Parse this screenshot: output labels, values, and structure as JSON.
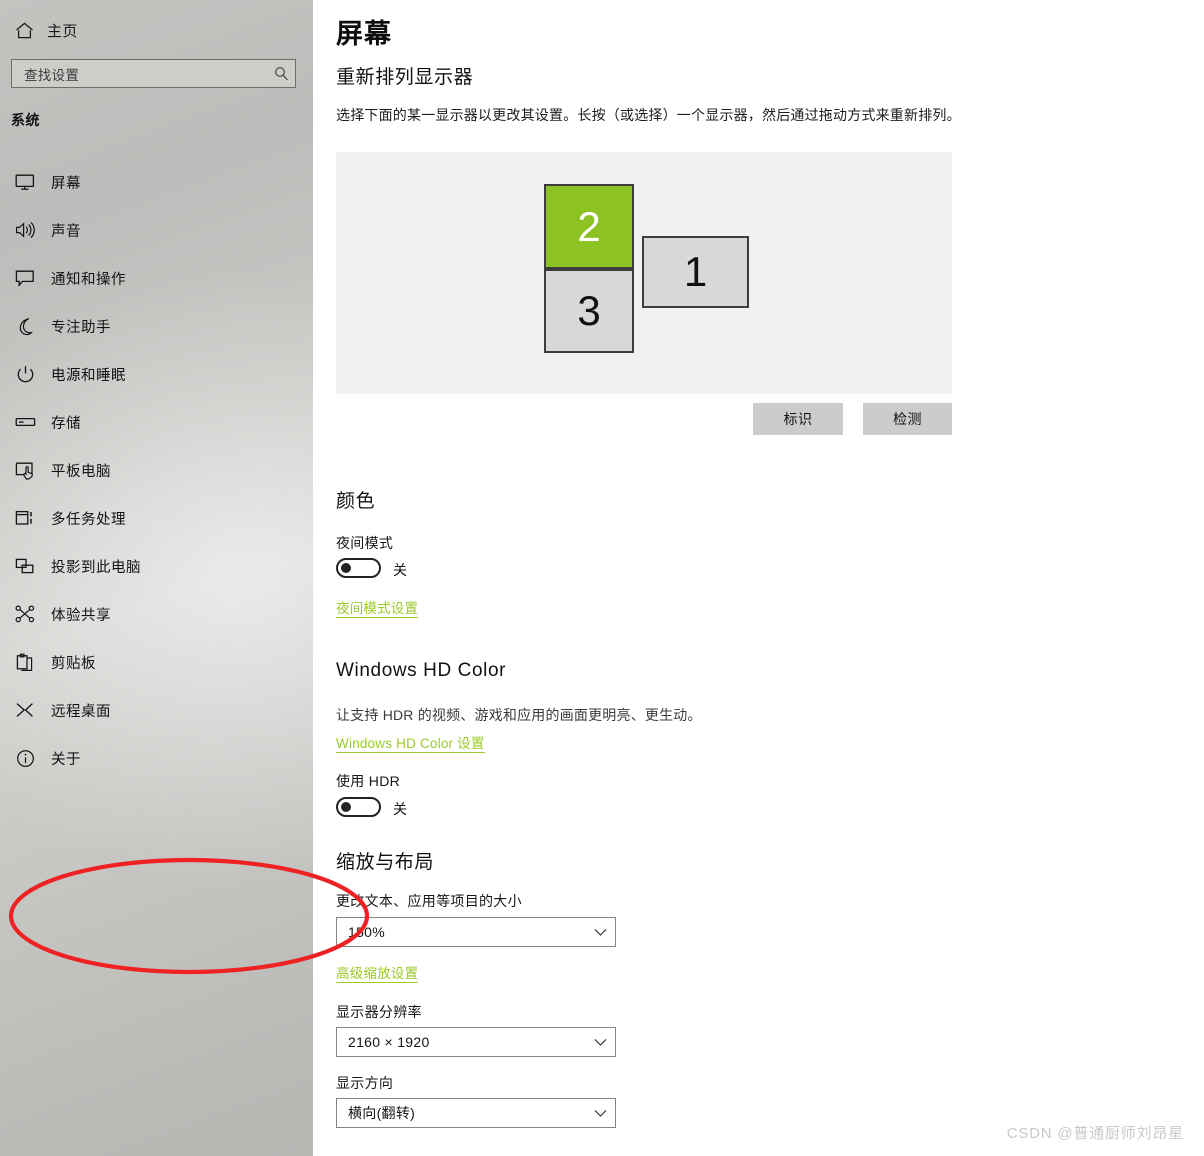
{
  "sidebar": {
    "home": {
      "label": "主页",
      "icon": "home-icon"
    },
    "search": {
      "value": "查找设置",
      "placeholder": "查找设置",
      "icon": "search-icon"
    },
    "heading": "系统",
    "items": [
      {
        "label": "屏幕",
        "icon": "monitor-icon",
        "selected": true
      },
      {
        "label": "声音",
        "icon": "speaker-icon",
        "selected": false
      },
      {
        "label": "通知和操作",
        "icon": "notification-icon",
        "selected": false
      },
      {
        "label": "专注助手",
        "icon": "moon-icon",
        "selected": false
      },
      {
        "label": "电源和睡眠",
        "icon": "power-icon",
        "selected": false
      },
      {
        "label": "存储",
        "icon": "storage-icon",
        "selected": false
      },
      {
        "label": "平板电脑",
        "icon": "tablet-icon",
        "selected": false
      },
      {
        "label": "多任务处理",
        "icon": "multitask-icon",
        "selected": false
      },
      {
        "label": "投影到此电脑",
        "icon": "projection-icon",
        "selected": false
      },
      {
        "label": "体验共享",
        "icon": "share-icon",
        "selected": false
      },
      {
        "label": "剪贴板",
        "icon": "clipboard-icon",
        "selected": false
      },
      {
        "label": "远程桌面",
        "icon": "remote-desktop-icon",
        "selected": false
      },
      {
        "label": "关于",
        "icon": "info-icon",
        "selected": false
      }
    ]
  },
  "main": {
    "page_title": "屏幕",
    "rearrange": {
      "heading": "重新排列显示器",
      "description": "选择下面的某一显示器以更改其设置。长按（或选择）一个显示器，然后通过拖动方式来重新排列。",
      "monitors": [
        {
          "number": "2",
          "selected": true,
          "color": "#8cc323"
        },
        {
          "number": "3",
          "selected": false,
          "color": "#d8d8d8"
        },
        {
          "number": "1",
          "selected": false,
          "color": "#d8d8d8"
        }
      ],
      "identify_button": "标识",
      "detect_button": "检测"
    },
    "color_section": {
      "heading": "颜色",
      "night_light_label": "夜间模式",
      "night_light_state": "关",
      "night_light_link": "夜间模式设置"
    },
    "hd_color_section": {
      "heading": "Windows HD Color",
      "description": "让支持 HDR 的视频、游戏和应用的画面更明亮、更生动。",
      "link": "Windows HD Color 设置",
      "hdr_label": "使用 HDR",
      "hdr_state": "关"
    },
    "scale_section": {
      "heading": "缩放与布局",
      "scale_label": "更改文本、应用等项目的大小",
      "scale_value": "150%",
      "advanced_link": "高级缩放设置",
      "resolution_label": "显示器分辨率",
      "resolution_value": "2160 × 1920",
      "orientation_label": "显示方向",
      "orientation_value": "横向(翻转)"
    }
  },
  "annotation": {
    "shape": "red-ellipse",
    "color": "#ee2222"
  },
  "watermark": {
    "text": "CSDN @普通厨师刘昂星"
  },
  "colors": {
    "accent_green": "#9cc92b",
    "monitor_selected": "#8cc323",
    "annotation_red": "#ee2222",
    "sidebar_base": "#c6c6c3"
  }
}
